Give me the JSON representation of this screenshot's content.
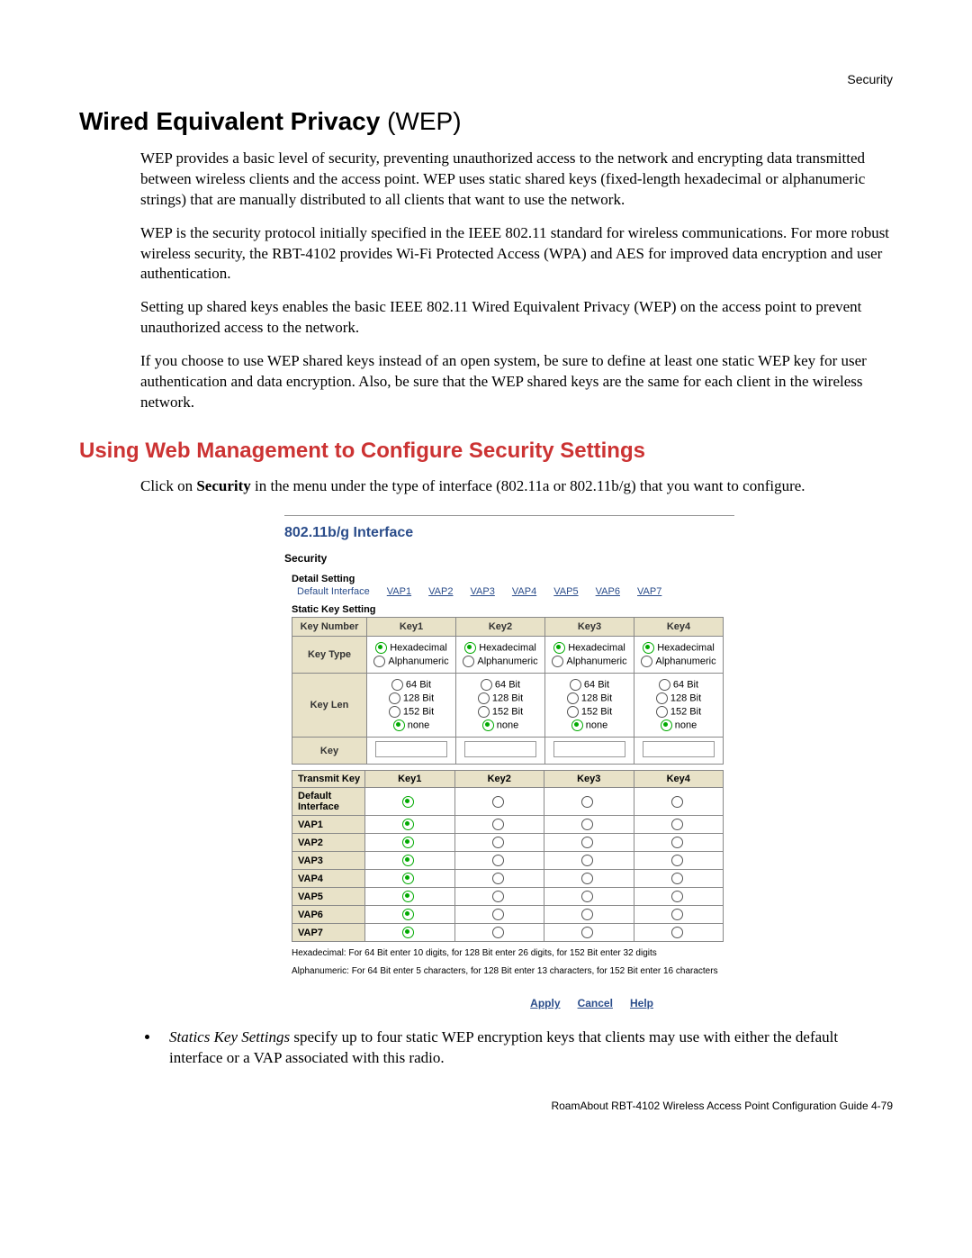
{
  "header_right": "Security",
  "title_bold": "Wired Equivalent Privacy",
  "title_rest": " (WEP)",
  "paras": {
    "p1": "WEP provides a basic level of security, preventing unauthorized access to the network and encrypting data transmitted between wireless clients and the access point. WEP uses static shared keys (fixed-length hexadecimal or alphanumeric strings) that are manually distributed to all clients that want to use the network.",
    "p2": "WEP is the security protocol initially specified in the IEEE 802.11 standard for wireless communications. For more robust wireless security, the RBT-4102 provides Wi-Fi Protected Access (WPA) and AES for improved data encryption and user authentication.",
    "p3": "Setting up shared keys enables the basic IEEE 802.11 Wired Equivalent Privacy (WEP) on the access point to prevent unauthorized access to the network.",
    "p4": "If you choose to use WEP shared keys instead of an open system, be sure to define at least one static WEP key for user authentication and data encryption. Also, be sure that the WEP shared keys are the same for each client in the wireless network."
  },
  "h2": "Using Web Management to Configure Security Settings",
  "p5a": "Click on ",
  "p5bold": "Security",
  "p5b": " in the menu under the type of interface (802.11a or 802.11b/g) that you want to configure.",
  "fig": {
    "title": "802.11b/g Interface",
    "sub": "Security",
    "detail_label": "Detail Setting",
    "tabs": [
      "Default Interface",
      "VAP1",
      "VAP2",
      "VAP3",
      "VAP4",
      "VAP5",
      "VAP6",
      "VAP7"
    ],
    "sks_label": "Static Key Setting",
    "cols": [
      "Key1",
      "Key2",
      "Key3",
      "Key4"
    ],
    "row_keynum": "Key Number",
    "row_keytype": "Key Type",
    "row_keylen": "Key Len",
    "row_key": "Key",
    "keytype_opts": [
      "Hexadecimal",
      "Alphanumeric"
    ],
    "keylen_opts": [
      "64 Bit",
      "128 Bit",
      "152 Bit",
      "none"
    ],
    "trans_hdr": "Transmit Key",
    "trans_rows": [
      "Default Interface",
      "VAP1",
      "VAP2",
      "VAP3",
      "VAP4",
      "VAP5",
      "VAP6",
      "VAP7"
    ],
    "note1": "Hexadecimal: For 64 Bit enter 10 digits, for 128 Bit enter 26 digits, for 152 Bit enter 32 digits",
    "note2": "Alphanumeric: For 64 Bit enter 5 characters, for 128 Bit enter 13 characters, for 152 Bit enter 16 characters",
    "note1b": "Hexadecimal:",
    "note2b": "Alphanumeric:",
    "actions": {
      "apply": "Apply",
      "cancel": "Cancel",
      "help": "Help"
    }
  },
  "bullet_em": "Statics Key Settings",
  "bullet_rest": " specify up to four static WEP encryption keys that clients may use with either the default interface or a VAP associated with this radio.",
  "footer": "RoamAbout RBT-4102 Wireless Access Point Configuration Guide   4-79"
}
